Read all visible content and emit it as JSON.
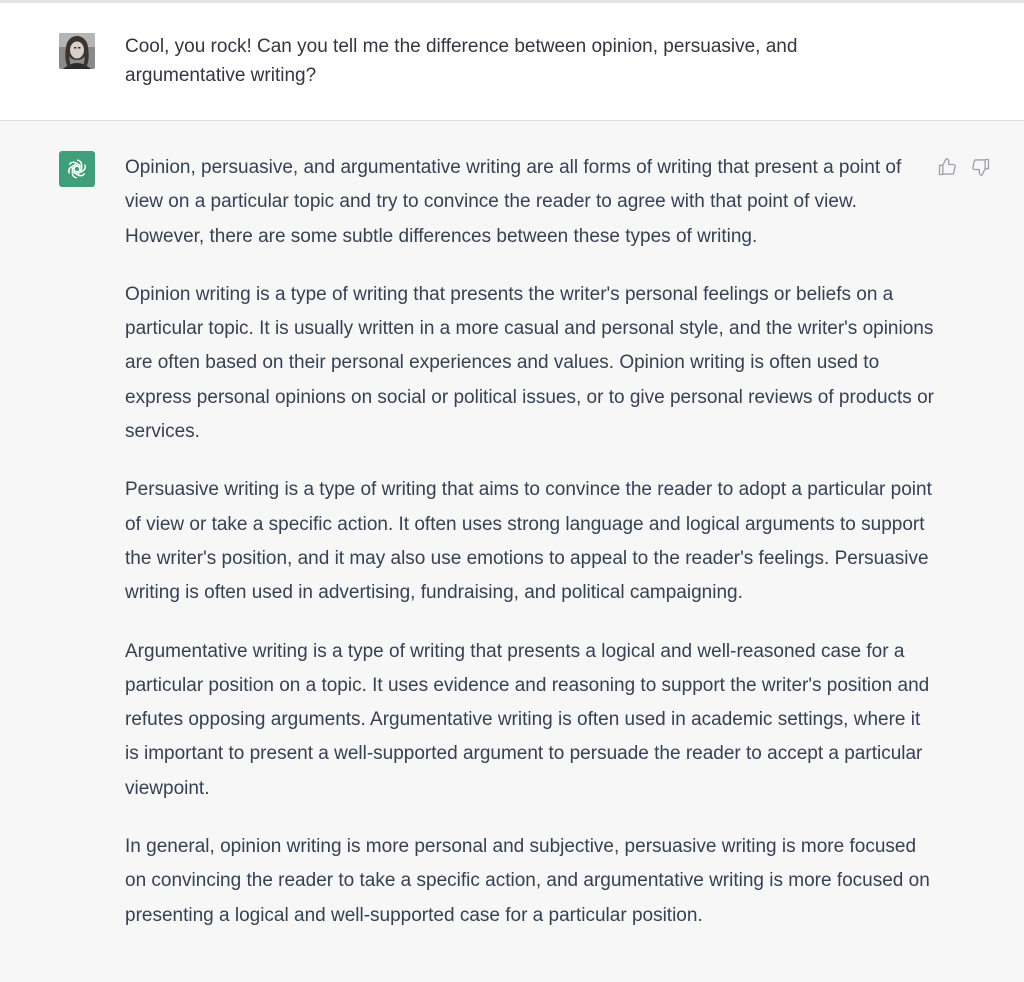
{
  "conversation": {
    "user_message": {
      "text": "Cool, you rock! Can you tell me the difference between opinion, persuasive, and argumentative writing?"
    },
    "assistant_message": {
      "paragraphs": [
        "Opinion, persuasive, and argumentative writing are all forms of writing that present a point of view on a particular topic and try to convince the reader to agree with that point of view. However, there are some subtle differences between these types of writing.",
        "Opinion writing is a type of writing that presents the writer's personal feelings or beliefs on a particular topic. It is usually written in a more casual and personal style, and the writer's opinions are often based on their personal experiences and values. Opinion writing is often used to express personal opinions on social or political issues, or to give personal reviews of products or services.",
        "Persuasive writing is a type of writing that aims to convince the reader to adopt a particular point of view or take a specific action. It often uses strong language and logical arguments to support the writer's position, and it may also use emotions to appeal to the reader's feelings. Persuasive writing is often used in advertising, fundraising, and political campaigning.",
        "Argumentative writing is a type of writing that presents a logical and well-reasoned case for a particular position on a topic. It uses evidence and reasoning to support the writer's position and refutes opposing arguments. Argumentative writing is often used in academic settings, where it is important to present a well-supported argument to persuade the reader to accept a particular viewpoint.",
        "In general, opinion writing is more personal and subjective, persuasive writing is more focused on convincing the reader to take a specific action, and argumentative writing is more focused on presenting a logical and well-supported case for a particular position."
      ]
    }
  },
  "icons": {
    "user_avatar": "user-avatar-photo",
    "assistant_avatar": "openai-logo-icon",
    "thumbs_up": "thumbs-up-icon",
    "thumbs_down": "thumbs-down-icon"
  },
  "colors": {
    "assistant_avatar_bg": "#3f9f7b",
    "assistant_row_bg": "#f7f7f8",
    "user_row_bg": "#ffffff",
    "text": "#374151"
  }
}
